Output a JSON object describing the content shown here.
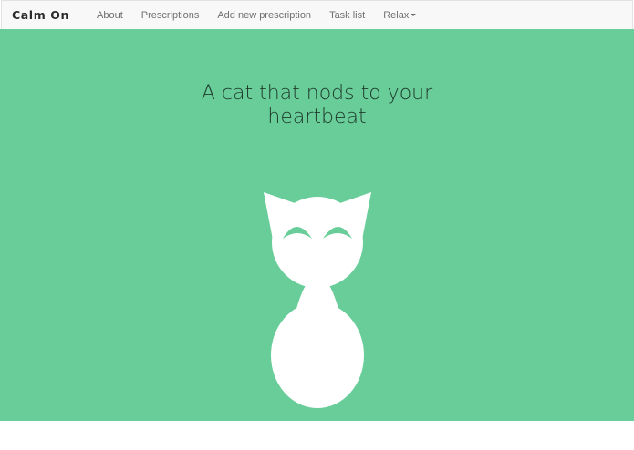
{
  "app": {
    "brand": "Calm On"
  },
  "nav": {
    "items": [
      {
        "label": "About"
      },
      {
        "label": "Prescriptions"
      },
      {
        "label": "Add new prescription"
      },
      {
        "label": "Task list"
      },
      {
        "label": "Relax"
      }
    ]
  },
  "main": {
    "headline_line1": "A cat that nods to your",
    "headline_line2": "heartbeat",
    "background_color": "#68cd99",
    "illustration": "cat-icon"
  }
}
